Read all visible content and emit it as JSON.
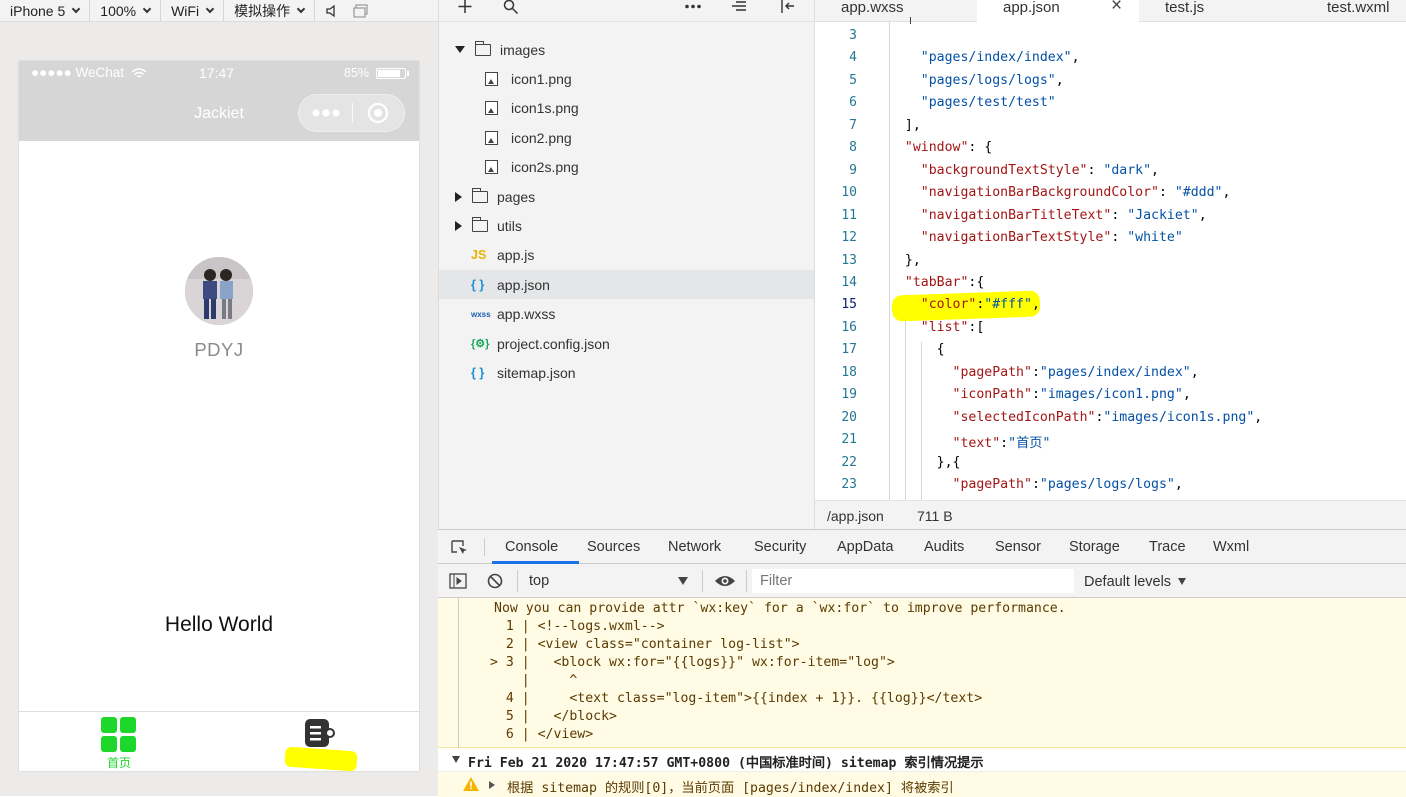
{
  "simulator": {
    "device": "iPhone 5",
    "zoom": "100%",
    "network": "WiFi",
    "mode": "模拟操作",
    "status": {
      "carrier": "●●●●● WeChat",
      "time": "17:47",
      "battery": "85%",
      "battery_level": 0.85
    },
    "nav_title": "Jackiet",
    "username": "PDYJ",
    "hello": "Hello World",
    "tabbar": [
      {
        "label": "首页",
        "color": "#1ed72b",
        "icon": "grid-icon"
      },
      {
        "label": "",
        "color": "#333333",
        "icon": "logs-icon"
      }
    ]
  },
  "explorer": {
    "items": [
      {
        "label": "images",
        "type": "folder-open",
        "level": 0
      },
      {
        "label": "icon1.png",
        "type": "image",
        "level": 1
      },
      {
        "label": "icon1s.png",
        "type": "image",
        "level": 1
      },
      {
        "label": "icon2.png",
        "type": "image",
        "level": 1
      },
      {
        "label": "icon2s.png",
        "type": "image",
        "level": 1
      },
      {
        "label": "pages",
        "type": "folder-closed",
        "level": 0
      },
      {
        "label": "utils",
        "type": "folder-closed",
        "level": 0
      },
      {
        "label": "app.js",
        "type": "js",
        "level": 0
      },
      {
        "label": "app.json",
        "type": "json",
        "level": 0,
        "selected": true
      },
      {
        "label": "app.wxss",
        "type": "wxss",
        "level": 0
      },
      {
        "label": "project.config.json",
        "type": "config",
        "level": 0
      },
      {
        "label": "sitemap.json",
        "type": "json",
        "level": 0
      }
    ],
    "icon_labels": {
      "js": "JS",
      "json": "{ }",
      "wxss": "wxss",
      "config": "{⚙}"
    }
  },
  "editor": {
    "tabs": [
      {
        "label": "app.wxss"
      },
      {
        "label": "app.json",
        "active": true,
        "close": "×"
      },
      {
        "label": "test.js"
      },
      {
        "label": "test.wxml"
      }
    ],
    "lines": [
      {
        "n": "3",
        "text": ""
      },
      {
        "n": "4",
        "text": "    \"pages/index/index\","
      },
      {
        "n": "5",
        "text": "    \"pages/logs/logs\","
      },
      {
        "n": "6",
        "text": "    \"pages/test/test\""
      },
      {
        "n": "7",
        "text": "  ],"
      },
      {
        "n": "8",
        "text": "  \"window\": {"
      },
      {
        "n": "9",
        "text": "    \"backgroundTextStyle\": \"dark\","
      },
      {
        "n": "10",
        "text": "    \"navigationBarBackgroundColor\": \"#ddd\","
      },
      {
        "n": "11",
        "text": "    \"navigationBarTitleText\": \"Jackiet\","
      },
      {
        "n": "12",
        "text": "    \"navigationBarTextStyle\": \"white\""
      },
      {
        "n": "13",
        "text": "  },"
      },
      {
        "n": "14",
        "text": "  \"tabBar\":{"
      },
      {
        "n": "15",
        "text": "    \"color\":\"#fff\","
      },
      {
        "n": "16",
        "text": "    \"list\":["
      },
      {
        "n": "17",
        "text": "      {"
      },
      {
        "n": "18",
        "text": "        \"pagePath\":\"pages/index/index\","
      },
      {
        "n": "19",
        "text": "        \"iconPath\":\"images/icon1.png\","
      },
      {
        "n": "20",
        "text": "        \"selectedIconPath\":\"images/icon1s.png\","
      },
      {
        "n": "21",
        "text": "        \"text\":\"首页\""
      },
      {
        "n": "22",
        "text": "      },{"
      },
      {
        "n": "23",
        "text": "        \"pagePath\":\"pages/logs/logs\","
      }
    ],
    "status_path": "/app.json",
    "status_size": "711 B"
  },
  "devtools": {
    "tabs": [
      "Console",
      "Sources",
      "Network",
      "Security",
      "AppData",
      "Audits",
      "Sensor",
      "Storage",
      "Trace",
      "Wxml"
    ],
    "active_tab": "Console",
    "context": "top",
    "filter_placeholder": "Filter",
    "levels": "Default levels",
    "warning_title": "Now you can provide attr `wx:key` for a `wx:for` to improve performance.",
    "warning_code": [
      "   1 | <!--logs.wxml-->",
      "   2 | <view class=\"container log-list\">",
      " > 3 |   <block wx:for=\"{{logs}}\" wx:for-item=\"log\">",
      "     |     ^",
      "   4 |     <text class=\"log-item\">{{index + 1}}. {{log}}</text>",
      "   5 |   </block>",
      "   6 | </view>"
    ],
    "group_header": "Fri Feb 21 2020 17:47:57 GMT+0800 (中国标准时间) sitemap 索引情况提示",
    "sitemap_msg": "根据 sitemap 的规则[0]，当前页面 [pages/index/index] 将被索引"
  },
  "highlight_color": "#ffff00"
}
